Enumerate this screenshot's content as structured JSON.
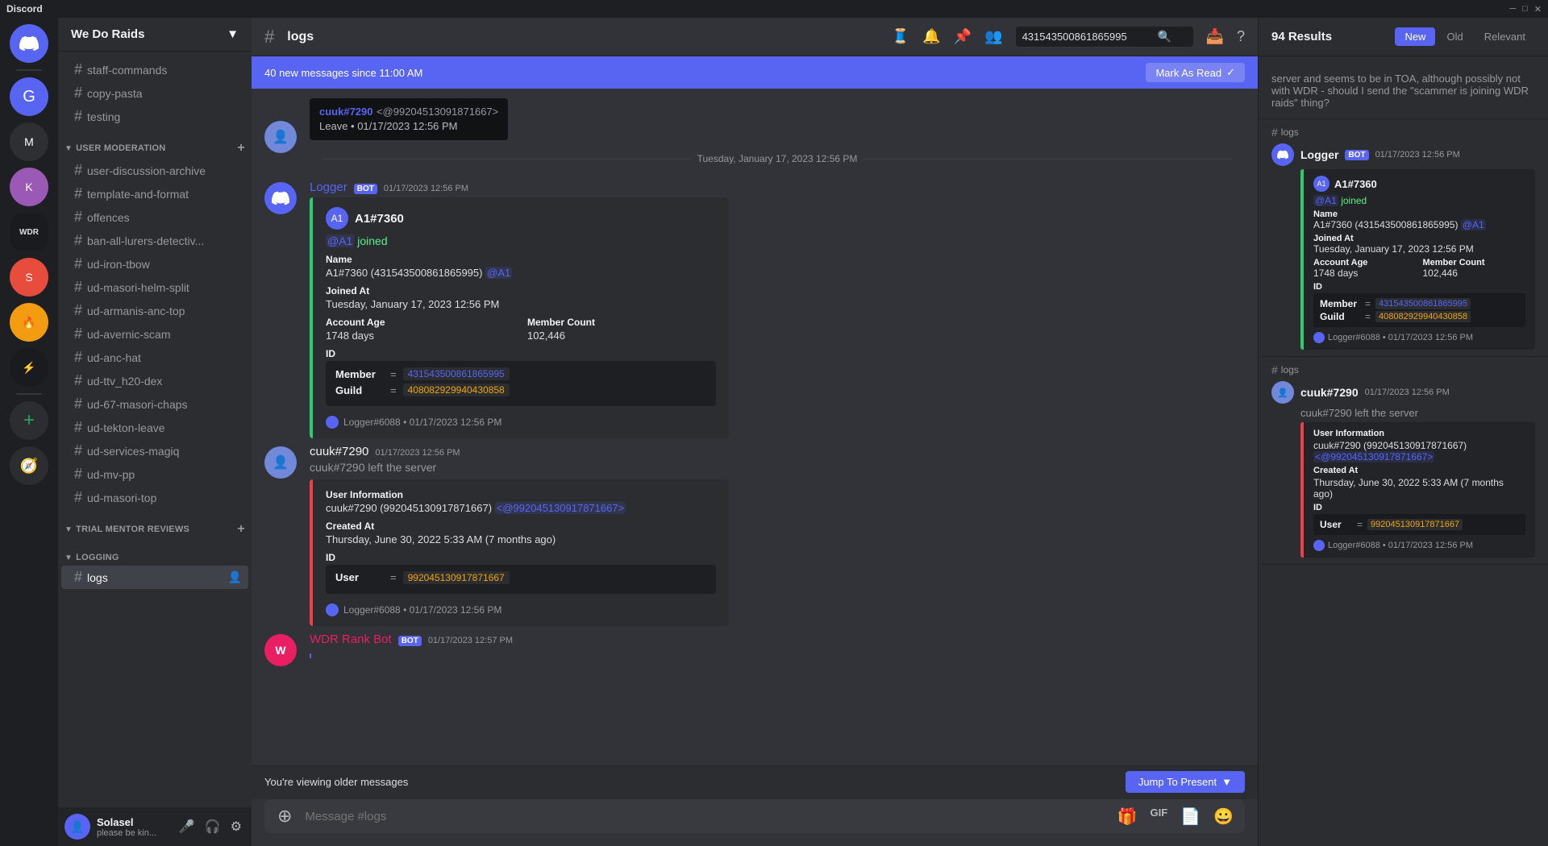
{
  "titleBar": {
    "title": "Discord",
    "appName": "Discord",
    "controls": [
      "minimize",
      "maximize",
      "close"
    ]
  },
  "serverSidebar": {
    "servers": [
      {
        "id": "discord-logo",
        "label": "Discord",
        "icon": "💬",
        "color": "#5865f2"
      },
      {
        "id": "server-1",
        "label": "Server 1",
        "icon": "G",
        "color": "#5865f2"
      },
      {
        "id": "server-2",
        "label": "Server 2",
        "icon": "M",
        "color": "#2ecc71"
      },
      {
        "id": "server-3",
        "label": "Server 3",
        "icon": "K",
        "color": "#9b59b6"
      },
      {
        "id": "server-wdr",
        "label": "We Do Raids",
        "icon": "WDR",
        "color": "#1a1b1e"
      },
      {
        "id": "server-5",
        "label": "Server 5",
        "icon": "S",
        "color": "#e74c3c"
      },
      {
        "id": "server-add",
        "label": "Add Server",
        "icon": "+",
        "color": "#23a55a"
      },
      {
        "id": "server-discover",
        "label": "Discover",
        "icon": "🧭",
        "color": "#23a55a"
      }
    ]
  },
  "channelSidebar": {
    "serverName": "We Do Raids",
    "channels": [
      {
        "id": "staff-commands",
        "name": "staff-commands",
        "type": "text",
        "active": false
      },
      {
        "id": "copy-pasta",
        "name": "copy-pasta",
        "type": "text",
        "active": false
      },
      {
        "id": "testing",
        "name": "# testing",
        "type": "text",
        "active": false,
        "section": null
      }
    ],
    "sections": [
      {
        "id": "user-moderation",
        "name": "USER MODERATION",
        "collapsed": false,
        "channels": [
          {
            "id": "user-discussion-archive",
            "name": "user-discussion-archive",
            "type": "text"
          },
          {
            "id": "template-and-format",
            "name": "template-and-format",
            "type": "text"
          },
          {
            "id": "offences",
            "name": "# offences",
            "type": "text"
          },
          {
            "id": "ban-all-lurers-detectiv",
            "name": "ban-all-lurers-detectiv...",
            "type": "text"
          },
          {
            "id": "ud-iron-tbow",
            "name": "ud-iron-tbow",
            "type": "text"
          },
          {
            "id": "ud-masori-helm-split",
            "name": "ud-masori-helm-split",
            "type": "text"
          },
          {
            "id": "ud-armanis-anc-top",
            "name": "ud-armanis-anc-top",
            "type": "text"
          },
          {
            "id": "ud-avernic-scam",
            "name": "ud-avernic-scam",
            "type": "text"
          },
          {
            "id": "ud-anc-hat",
            "name": "ud-anc-hat",
            "type": "text"
          },
          {
            "id": "ud-ttv-h20-dex",
            "name": "ud-ttv_h20-dex",
            "type": "text"
          },
          {
            "id": "ud-67-masori-chaps",
            "name": "ud-67-masori-chaps",
            "type": "text"
          },
          {
            "id": "ud-tekton-leave",
            "name": "ud-tekton-leave",
            "type": "text"
          },
          {
            "id": "ud-services-magiq",
            "name": "ud-services-magiq",
            "type": "text"
          },
          {
            "id": "ud-mv-pp",
            "name": "ud-mv-pp",
            "type": "text"
          },
          {
            "id": "ud-masori-top",
            "name": "ud-masori-top",
            "type": "text"
          }
        ]
      },
      {
        "id": "trial-mentor-reviews",
        "name": "TRIAL MENTOR REVIEWS",
        "collapsed": false,
        "channels": []
      },
      {
        "id": "logging",
        "name": "LOGGING",
        "collapsed": false,
        "channels": [
          {
            "id": "logs",
            "name": "logs",
            "type": "text",
            "active": true
          }
        ]
      }
    ],
    "userArea": {
      "username": "Solasel",
      "status": "please be kin...",
      "avatarColor": "#5865f2"
    }
  },
  "channelHeader": {
    "channelName": "logs",
    "searchValue": "431543500861865995"
  },
  "newMessagesBanner": {
    "text": "40 new messages since 11:00 AM",
    "markAsReadLabel": "Mark As Read"
  },
  "messages": [
    {
      "id": "msg-leave-popup",
      "type": "leave-popup",
      "user": "cuuk#7290",
      "userId": "@99204513091871667>",
      "action": "Leave",
      "timestamp": "01/17/2023 12:56 PM",
      "dateDivider": "Tuesday, January 17, 2023 12:56 PM"
    },
    {
      "id": "msg-logger-join",
      "type": "embed",
      "author": "Logger",
      "authorColor": "#5865f2",
      "isBot": true,
      "timestamp": "01/17/2023 12:56 PM",
      "avatarColor": "#5865f2",
      "embed": {
        "borderColor": "#2ecc71",
        "embedUsername": "A1#7360",
        "embedAvatarColor": "#5865f2",
        "joinedText": "@A1 joined",
        "fields": [
          {
            "label": "Name",
            "value": "A1#7360 (431543500861865995) @A1",
            "full": true
          },
          {
            "label": "Joined At",
            "value": "Tuesday, January 17, 2023 12:56 PM",
            "full": true
          },
          {
            "label": "Account Age",
            "value": "1748 days"
          },
          {
            "label": "Member Count",
            "value": "102,446"
          },
          {
            "label": "ID",
            "full": true,
            "isIdBlock": true,
            "ids": [
              {
                "label": "Member",
                "value": "431543500861865995",
                "color": "blue"
              },
              {
                "label": "Guild",
                "value": "408082929940430858",
                "color": "orange"
              }
            ]
          }
        ],
        "footer": "Logger#6088 • 01/17/2023 12:56 PM"
      }
    },
    {
      "id": "msg-logger-leave",
      "type": "embed",
      "author": "cuuk#7290",
      "isBot": false,
      "timestamp": "01/17/2023 12:56 PM",
      "avatarColor": "#7289da",
      "leftText": "cuuk#7290 left the server",
      "embed": {
        "borderColor": "#ed4245",
        "fields": [
          {
            "label": "User Information",
            "value": "cuuk#7290 (992045130917871667) <@992045130917871667>",
            "full": true
          },
          {
            "label": "Created At",
            "value": "Thursday, June 30, 2022 5:33 AM (7 months ago)",
            "full": true
          },
          {
            "label": "ID",
            "full": true,
            "isIdBlock": true,
            "ids": [
              {
                "label": "User",
                "value": "992045130917871667",
                "color": "orange"
              }
            ]
          }
        ],
        "footer": "Logger#6088 • 01/17/2023 12:56 PM"
      }
    },
    {
      "id": "msg-wdr-rank-bot",
      "type": "simple",
      "author": "WDR Rank Bot",
      "isBot": true,
      "timestamp": "01/17/2023 12:57 PM",
      "avatarColor": "#e91e63"
    }
  ],
  "olderMessagesBar": {
    "text": "You're viewing older messages",
    "jumpLabel": "Jump To Present"
  },
  "messageInput": {
    "placeholder": "Message #logs"
  },
  "rightPanel": {
    "resultsCount": "94 Results",
    "filters": [
      {
        "label": "New",
        "active": true
      },
      {
        "label": "Old",
        "active": false
      },
      {
        "label": "Relevant",
        "active": false
      }
    ],
    "contextText": "server and seems to be in TOA, although possibly not with WDR - should I send the \"scammer is joining WDR raids\" thing?",
    "channelRef": "# logs",
    "results": [
      {
        "id": "result-1",
        "author": "Logger",
        "isBot": true,
        "timestamp": "01/17/2023 12:56 PM",
        "avatarColor": "#5865f2",
        "embed": {
          "borderColor": "#2ecc71",
          "embedUsername": "A1#7360",
          "joinedText": "@A1 joined",
          "fields": [
            {
              "label": "Name",
              "value": "A1#7360 (431543500861865995) @A1",
              "full": true
            },
            {
              "label": "Joined At",
              "value": "Tuesday, January 17, 2023 12:56 PM",
              "full": true
            },
            {
              "label": "Account Age",
              "value": "1748 days"
            },
            {
              "label": "Member Count",
              "value": "102,446"
            },
            {
              "label": "ID",
              "full": true,
              "isIdBlock": true,
              "ids": [
                {
                  "label": "Member",
                  "value": "431543500861865995",
                  "color": "blue"
                },
                {
                  "label": "Guild",
                  "value": "408082929940430858",
                  "color": "orange"
                }
              ]
            }
          ],
          "footer": "Logger#6088 • 01/17/2023 12:56 PM"
        }
      },
      {
        "id": "result-2",
        "author": "cuuk#7290",
        "isBot": false,
        "timestamp": "01/17/2023 12:56 PM",
        "avatarColor": "#7289da",
        "leftText": "cuuk#7290 left the server",
        "embed": {
          "borderColor": "#ed4245",
          "fields": [
            {
              "label": "User Information",
              "value": "cuuk#7290 (992045130917871667) <@992045130917871667>",
              "full": true
            },
            {
              "label": "Created At",
              "value": "Thursday, June 30, 2022 5:33 AM (7 months ago)",
              "full": true
            },
            {
              "label": "ID",
              "full": true,
              "isIdBlock": true,
              "ids": [
                {
                  "label": "User",
                  "value": "992045130917871667",
                  "color": "orange"
                }
              ]
            }
          ],
          "footer": "Logger#6088 • 01/17/2023 12:56 PM"
        }
      }
    ]
  },
  "icons": {
    "hash": "#",
    "chevronDown": "▼",
    "chevronRight": "▶",
    "add": "+",
    "search": "🔍",
    "pin": "📌",
    "userAdd": "👤",
    "helpCircle": "?",
    "mic": "🎤",
    "headphones": "🎧",
    "settings": "⚙",
    "close": "✕",
    "minimize": "─",
    "maximize": "□",
    "reaction": "😊",
    "reply": "↩",
    "more": "•••",
    "gift": "🎁",
    "gif": "GIF",
    "apps": "⊞",
    "emoji": "😀",
    "thread": "🧵",
    "inbox": "📥",
    "markRead": "✓"
  }
}
